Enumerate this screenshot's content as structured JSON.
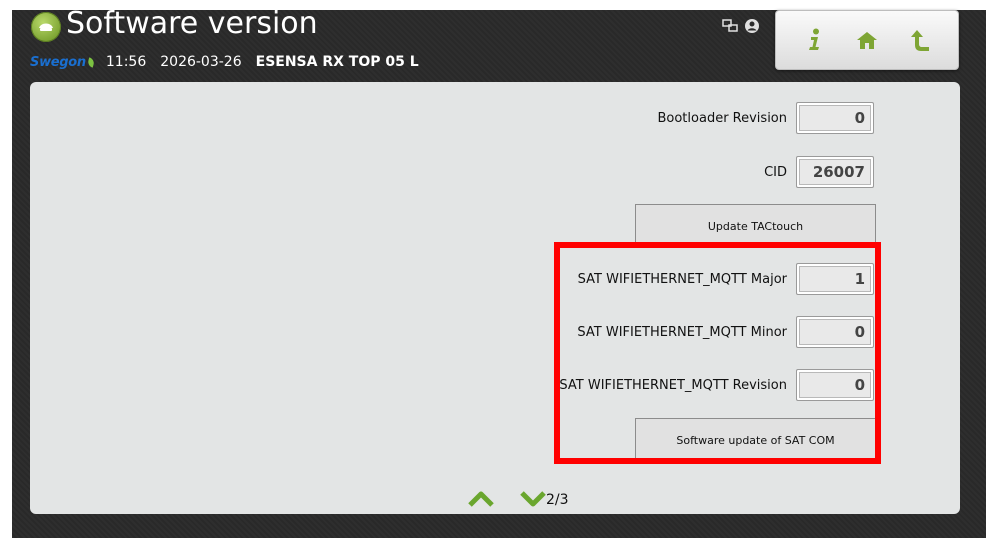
{
  "header": {
    "title": "Software version",
    "brand": "Swegon",
    "time": "11:56",
    "date": "2026-03-26",
    "unit_name": "ESENSA RX TOP 05 L"
  },
  "nav": {
    "info_icon": "info-icon",
    "home_icon": "home-icon",
    "back_icon": "back-arrow-icon"
  },
  "fields": {
    "bootloader_revision": {
      "label": "Bootloader Revision",
      "value": "0"
    },
    "cid": {
      "label": "CID",
      "value": "26007"
    },
    "sat_major": {
      "label": "SAT WIFIETHERNET_MQTT Major",
      "value": "1"
    },
    "sat_minor": {
      "label": "SAT WIFIETHERNET_MQTT Minor",
      "value": "0"
    },
    "sat_revision": {
      "label": "SAT WIFIETHERNET_MQTT Revision",
      "value": "0"
    }
  },
  "buttons": {
    "update_tactouch": "Update TACtouch",
    "sat_update": "Software update of SAT COM"
  },
  "pager": {
    "page": "2/3"
  },
  "colors": {
    "highlight": "#ff0000",
    "accent_green": "#7ea534",
    "brand_blue": "#1a6fd0"
  }
}
